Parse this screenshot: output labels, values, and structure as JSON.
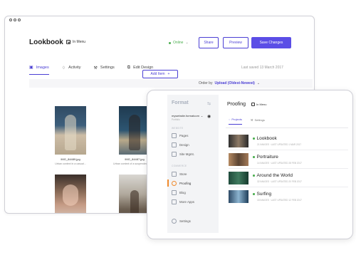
{
  "back": {
    "title": "Lookbook",
    "in_menu": "In Menu",
    "status": "Online",
    "buttons": {
      "share": "Share",
      "preview": "Preview",
      "save": "Save Changes"
    },
    "tabs": [
      "Images",
      "Activity",
      "Settings",
      "Edit Design"
    ],
    "saved": "Last saved 13 March 2017",
    "order_label": "Order by",
    "order_value": "Upload (Oldest-Newest)",
    "add_item": "Add Item",
    "images": [
      {
        "file": "IMG_84489.jpg",
        "caption": "Urban context in a casual..."
      },
      {
        "file": "IMG_84487.jpg",
        "caption": "Urban context of a suspended moment"
      }
    ]
  },
  "front": {
    "brand": "Format",
    "account": "mywebsite.formatcom",
    "account_sub": "Portfolio",
    "sections": {
      "website": "WEBSITE",
      "commerce": "COMMERCE"
    },
    "website_items": [
      "Pages",
      "Design",
      "Site Mgmt."
    ],
    "commerce_items": [
      "Store",
      "Proofing",
      "Blog",
      "More Apps"
    ],
    "bottom_item": "Settings",
    "title": "Proofing",
    "in_menu": "In Menu",
    "tabs": [
      "Projects",
      "Settings"
    ],
    "projects": [
      {
        "name": "Lookbook",
        "meta": "21 IMAGES · LAST UPDATED 1 MAR 2017"
      },
      {
        "name": "Portraiture",
        "meta": "14 IMAGES · LAST UPDATED 28 FEB 2017"
      },
      {
        "name": "Around the World",
        "meta": "32 IMAGES · LAST UPDATED 20 FEB 2017"
      },
      {
        "name": "Surfing",
        "meta": "18 IMAGES · LAST UPDATED 12 FEB 2017"
      }
    ]
  },
  "colors": {
    "accent": "#5b4ee6",
    "online": "#4caf50",
    "proofing_active": "#f08a2c"
  }
}
